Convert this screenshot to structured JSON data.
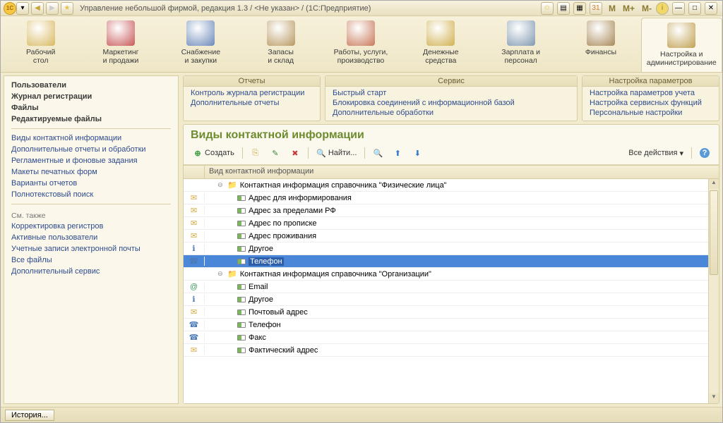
{
  "title": "Управление небольшой фирмой, редакция 1.3 / <Не указан> / (1С:Предприятие)",
  "titlebar_right": {
    "m": "M",
    "mplus": "M+",
    "mminus": "M-"
  },
  "nav": [
    {
      "label": "Рабочий\nстол",
      "color": "#d8b860"
    },
    {
      "label": "Маркетинг\nи продажи",
      "color": "#c85858"
    },
    {
      "label": "Снабжение\nи закупки",
      "color": "#6a88b8"
    },
    {
      "label": "Запасы\nи склад",
      "color": "#b89860"
    },
    {
      "label": "Работы, услуги,\nпроизводство",
      "color": "#c87858"
    },
    {
      "label": "Денежные\nсредства",
      "color": "#d0b050"
    },
    {
      "label": "Зарплата и\nперсонал",
      "color": "#8098b0"
    },
    {
      "label": "Финансы",
      "color": "#a88858"
    },
    {
      "label": "Настройка и\nадминистрирование",
      "color": "#c0a050",
      "active": true
    }
  ],
  "sidebar": {
    "bold": [
      "Пользователи",
      "Журнал регистрации",
      "Файлы",
      "Редактируемые файлы"
    ],
    "links": [
      "Виды контактной информации",
      "Дополнительные отчеты и обработки",
      "Регламентные и фоновые задания",
      "Макеты печатных форм",
      "Варианты отчетов",
      "Полнотекстовый поиск"
    ],
    "also_label": "См. также",
    "also": [
      "Корректировка регистров",
      "Активные пользователи",
      "Учетные записи электронной почты",
      "Все файлы",
      "Дополнительный сервис"
    ]
  },
  "panels": {
    "reports": {
      "title": "Отчеты",
      "links": [
        "Контроль журнала регистрации",
        "Дополнительные отчеты"
      ]
    },
    "service": {
      "title": "Сервис",
      "links": [
        "Быстрый старт",
        "Блокировка соединений с информационной базой",
        "Дополнительные обработки"
      ]
    },
    "settings": {
      "title": "Настройка параметров",
      "links": [
        "Настройка параметров учета",
        "Настройка сервисных функций",
        "Персональные настройки"
      ]
    }
  },
  "content": {
    "heading": "Виды контактной информации",
    "toolbar": {
      "create": "Создать",
      "find": "Найти...",
      "all_actions": "Все действия"
    },
    "grid_header": "Вид контактной информации",
    "rows": [
      {
        "icon": "",
        "type": "group",
        "label": "Контактная информация справочника \"Физические лица\"",
        "expand": "⊖"
      },
      {
        "icon": "✉",
        "type": "item",
        "label": "Адрес для информирования"
      },
      {
        "icon": "✉",
        "type": "item",
        "label": "Адрес за пределами РФ"
      },
      {
        "icon": "✉",
        "type": "item",
        "label": "Адрес по прописке"
      },
      {
        "icon": "✉",
        "type": "item",
        "label": "Адрес проживания"
      },
      {
        "icon": "ℹ",
        "type": "item",
        "label": "Другое"
      },
      {
        "icon": "☎",
        "type": "item",
        "label": "Телефон",
        "selected": true
      },
      {
        "icon": "",
        "type": "group",
        "label": "Контактная информация справочника \"Организации\"",
        "expand": "⊖"
      },
      {
        "icon": "@",
        "type": "item",
        "label": "Email"
      },
      {
        "icon": "ℹ",
        "type": "item",
        "label": "Другое"
      },
      {
        "icon": "✉",
        "type": "item",
        "label": "Почтовый адрес"
      },
      {
        "icon": "☎",
        "type": "item",
        "label": "Телефон"
      },
      {
        "icon": "☎",
        "type": "item",
        "label": "Факс"
      },
      {
        "icon": "✉",
        "type": "item",
        "label": "Фактический адрес"
      }
    ]
  },
  "statusbar": {
    "history": "История..."
  }
}
